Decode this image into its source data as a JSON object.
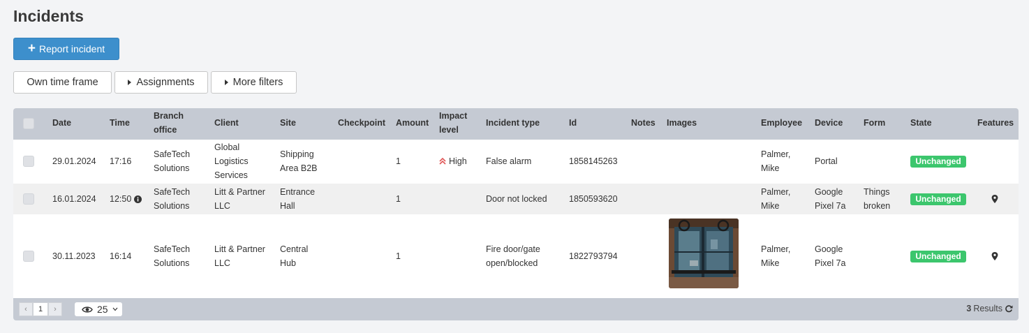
{
  "page": {
    "title": "Incidents"
  },
  "toolbar": {
    "report_label": "Report incident",
    "plus": "+"
  },
  "filters": {
    "own_time_frame": "Own time frame",
    "assignments": "Assignments",
    "more_filters": "More filters"
  },
  "table": {
    "headers": {
      "date": "Date",
      "time": "Time",
      "branch_office": [
        "Branch",
        "office"
      ],
      "client": "Client",
      "site": "Site",
      "checkpoint": "Checkpoint",
      "amount": "Amount",
      "impact_level": [
        "Impact",
        "level"
      ],
      "incident_type": "Incident type",
      "id": "Id",
      "notes": "Notes",
      "images": "Images",
      "employee": "Employee",
      "device": "Device",
      "form": "Form",
      "state": "State",
      "features": "Features"
    },
    "rows": [
      {
        "date": "29.01.2024",
        "time": "17:16",
        "branch_office": [
          "SafeTech",
          "Solutions"
        ],
        "client": [
          "Global",
          "Logistics",
          "Services"
        ],
        "site": [
          "Shipping",
          "Area B2B"
        ],
        "amount": "1",
        "impact_level": "High",
        "incident_type": [
          "False alarm"
        ],
        "id": "1858145263",
        "employee": [
          "Palmer,",
          "Mike"
        ],
        "device": [
          "Portal"
        ],
        "form": [],
        "state": "Unchanged"
      },
      {
        "date": "16.01.2024",
        "time": "12:50",
        "branch_office": [
          "SafeTech",
          "Solutions"
        ],
        "client": [
          "Litt & Partner",
          "LLC"
        ],
        "site": [
          "Entrance",
          "Hall"
        ],
        "amount": "1",
        "impact_level": "",
        "incident_type": [
          "Door not locked"
        ],
        "id": "1850593620",
        "employee": [
          "Palmer,",
          "Mike"
        ],
        "device": [
          "Google",
          "Pixel 7a"
        ],
        "form": [
          "Things",
          "broken"
        ],
        "state": "Unchanged"
      },
      {
        "date": "30.11.2023",
        "time": "16:14",
        "branch_office": [
          "SafeTech",
          "Solutions"
        ],
        "client": [
          "Litt & Partner",
          "LLC"
        ],
        "site": [
          "Central",
          "Hub"
        ],
        "amount": "1",
        "impact_level": "",
        "incident_type": [
          "Fire door/gate",
          "open/blocked"
        ],
        "id": "1822793794",
        "employee": [
          "Palmer,",
          "Mike"
        ],
        "device": [
          "Google",
          "Pixel 7a"
        ],
        "form": [],
        "state": "Unchanged"
      }
    ]
  },
  "footer": {
    "page_prev": "‹",
    "page_current": "1",
    "page_next": "›",
    "page_size": "25",
    "results_count": "3",
    "results_label": "Results"
  },
  "colors": {
    "primary": "#3d8fcc",
    "header_bg": "#c5cad3",
    "state_badge": "#3cc66d",
    "impact_high": "#e05555"
  },
  "icons": [
    "plus-icon",
    "caret-right-icon",
    "double-chevron-up-icon",
    "info-icon",
    "map-pin-icon",
    "eye-icon",
    "chevron-down-icon",
    "refresh-icon"
  ]
}
